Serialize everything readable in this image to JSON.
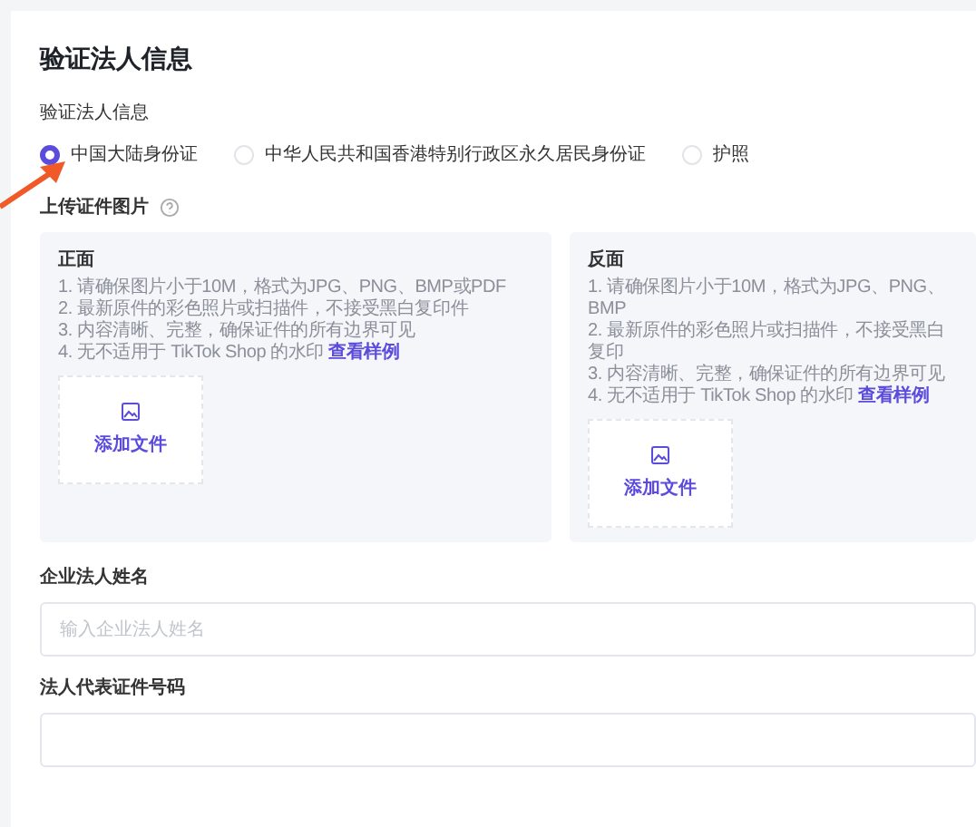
{
  "section_title": "验证法人信息",
  "id_type": {
    "label": "验证法人信息",
    "options": [
      {
        "label": "中国大陆身份证",
        "selected": true
      },
      {
        "label": "中华人民共和国香港特别行政区永久居民身份证",
        "selected": false
      },
      {
        "label": "护照",
        "selected": false
      }
    ]
  },
  "upload": {
    "label": "上传证件图片",
    "cards": [
      {
        "title": "正面",
        "rules": [
          "1. 请确保图片小于10M，格式为JPG、PNG、BMP或PDF",
          "2. 最新原件的彩色照片或扫描件，不接受黑白复印件",
          "3. 内容清晰、完整，确保证件的所有边界可见",
          "4. 无不适用于 TikTok Shop 的水印"
        ],
        "link": "查看样例",
        "button": "添加文件"
      },
      {
        "title": "反面",
        "rules": [
          "1. 请确保图片小于10M，格式为JPG、PNG、BMP",
          "2. 最新原件的彩色照片或扫描件，不接受黑白复印",
          "3. 内容清晰、完整，确保证件的所有边界可见",
          "4. 无不适用于 TikTok Shop 的水印"
        ],
        "link": "查看样例",
        "button": "添加文件"
      }
    ]
  },
  "fields": [
    {
      "label": "企业法人姓名",
      "placeholder": "输入企业法人姓名"
    },
    {
      "label": "法人代表证件号码"
    }
  ]
}
